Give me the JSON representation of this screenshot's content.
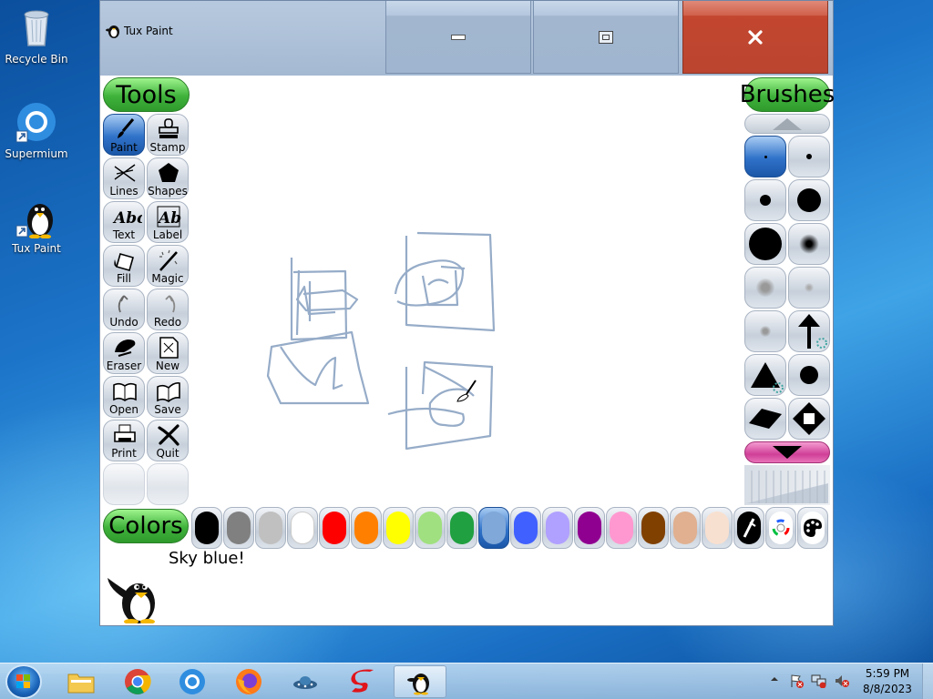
{
  "desktop": {
    "icons": [
      {
        "label": "Recycle Bin",
        "icon": "recycle-bin-icon"
      },
      {
        "label": "Supermium",
        "icon": "supermium-browser-icon"
      },
      {
        "label": "Tux Paint",
        "icon": "tux-penguin-icon"
      }
    ]
  },
  "window": {
    "title": "Tux Paint",
    "controls": {
      "minimize": "minimize-icon",
      "maximize": "maximize-icon",
      "close": "close-icon"
    }
  },
  "tools": {
    "header": "Tools",
    "items": [
      {
        "label": "Paint",
        "icon": "paintbrush-icon",
        "selected": true
      },
      {
        "label": "Stamp",
        "icon": "stamp-icon",
        "selected": false
      },
      {
        "label": "Lines",
        "icon": "lines-icon",
        "selected": false
      },
      {
        "label": "Shapes",
        "icon": "pentagon-icon",
        "selected": false
      },
      {
        "label": "Text",
        "icon": "text-abc-icon",
        "selected": false
      },
      {
        "label": "Label",
        "icon": "label-abc-icon",
        "selected": false
      },
      {
        "label": "Fill",
        "icon": "paint-bucket-icon",
        "selected": false
      },
      {
        "label": "Magic",
        "icon": "magic-wand-icon",
        "selected": false
      },
      {
        "label": "Undo",
        "icon": "undo-icon",
        "selected": false
      },
      {
        "label": "Redo",
        "icon": "redo-icon",
        "selected": false
      },
      {
        "label": "Eraser",
        "icon": "eraser-icon",
        "selected": false
      },
      {
        "label": "New",
        "icon": "new-page-icon",
        "selected": false
      },
      {
        "label": "Open",
        "icon": "open-book-icon",
        "selected": false
      },
      {
        "label": "Save",
        "icon": "save-book-icon",
        "selected": false
      },
      {
        "label": "Print",
        "icon": "printer-icon",
        "selected": false
      },
      {
        "label": "Quit",
        "icon": "quit-x-icon",
        "selected": false
      }
    ]
  },
  "brushes": {
    "header": "Brushes",
    "scroll_up": "scroll-up-arrow-icon",
    "scroll_down": "scroll-down-arrow-icon"
  },
  "colors": {
    "header": "Colors",
    "swatches": [
      "#000000",
      "#808080",
      "#c0c0c0",
      "#ffffff",
      "#ff0000",
      "#ff8000",
      "#ffff00",
      "#a0e080",
      "#20a040",
      "#80a8d8",
      "#4060ff",
      "#b0a0ff",
      "#900090",
      "#ff98d0",
      "#804000",
      "#e0b090",
      "#f8e0d0"
    ],
    "selected_index": 9,
    "extra": [
      "color-picker-icon",
      "color-wheel-icon",
      "palette-icon"
    ]
  },
  "status": {
    "message": "Sky blue!"
  },
  "taskbar": {
    "items": [
      "windows-start-icon",
      "file-explorer-icon",
      "chrome-icon",
      "supermium-icon",
      "firefox-icon",
      "ufo-app-icon",
      "red-s-app-icon",
      "tux-paint-icon"
    ],
    "active": "tux-paint-icon",
    "time": "5:59 PM",
    "date": "8/8/2023"
  }
}
